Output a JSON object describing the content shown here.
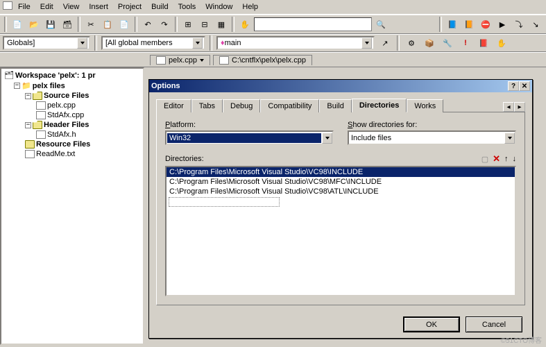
{
  "menu": {
    "items": [
      "File",
      "Edit",
      "View",
      "Insert",
      "Project",
      "Build",
      "Tools",
      "Window",
      "Help"
    ]
  },
  "combos": {
    "globals": "Globals]",
    "members": "[All global members",
    "symbol": "main"
  },
  "openFiles": {
    "tab1": "pelx.cpp",
    "tab2": "C:\\cntflx\\pelx\\pelx.cpp"
  },
  "workspace": {
    "title": "Workspace 'pelx': 1 pr",
    "project": "pelx files",
    "sourceFolder": "Source Files",
    "sources": [
      "pelx.cpp",
      "StdAfx.cpp"
    ],
    "headerFolder": "Header Files",
    "headers": [
      "StdAfx.h"
    ],
    "resourceFolder": "Resource Files",
    "readme": "ReadMe.txt"
  },
  "dialog": {
    "title": "Options",
    "tabs": [
      "Editor",
      "Tabs",
      "Debug",
      "Compatibility",
      "Build",
      "Directories",
      "Works"
    ],
    "activeTab": "Directories",
    "platformLabel": "Platform:",
    "platform": "Win32",
    "showDirLabel": "Show directories for:",
    "showDir": "Include files",
    "dirLabel": "Directories:",
    "dirs": [
      "C:\\Program Files\\Microsoft Visual Studio\\VC98\\INCLUDE",
      "C:\\Program Files\\Microsoft Visual Studio\\VC98\\MFC\\INCLUDE",
      "C:\\Program Files\\Microsoft Visual Studio\\VC98\\ATL\\INCLUDE"
    ],
    "ok": "OK",
    "cancel": "Cancel"
  },
  "watermark": "©51CTO博客"
}
